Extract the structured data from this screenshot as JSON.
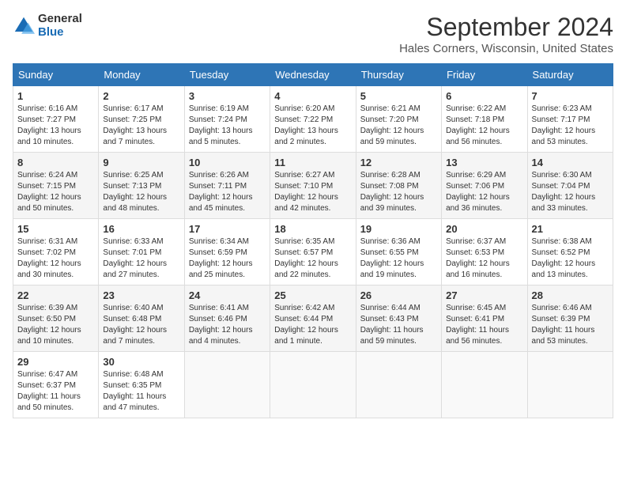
{
  "logo": {
    "general": "General",
    "blue": "Blue"
  },
  "title": "September 2024",
  "location": "Hales Corners, Wisconsin, United States",
  "weekdays": [
    "Sunday",
    "Monday",
    "Tuesday",
    "Wednesday",
    "Thursday",
    "Friday",
    "Saturday"
  ],
  "weeks": [
    [
      {
        "day": "1",
        "info": "Sunrise: 6:16 AM\nSunset: 7:27 PM\nDaylight: 13 hours and 10 minutes."
      },
      {
        "day": "2",
        "info": "Sunrise: 6:17 AM\nSunset: 7:25 PM\nDaylight: 13 hours and 7 minutes."
      },
      {
        "day": "3",
        "info": "Sunrise: 6:19 AM\nSunset: 7:24 PM\nDaylight: 13 hours and 5 minutes."
      },
      {
        "day": "4",
        "info": "Sunrise: 6:20 AM\nSunset: 7:22 PM\nDaylight: 13 hours and 2 minutes."
      },
      {
        "day": "5",
        "info": "Sunrise: 6:21 AM\nSunset: 7:20 PM\nDaylight: 12 hours and 59 minutes."
      },
      {
        "day": "6",
        "info": "Sunrise: 6:22 AM\nSunset: 7:18 PM\nDaylight: 12 hours and 56 minutes."
      },
      {
        "day": "7",
        "info": "Sunrise: 6:23 AM\nSunset: 7:17 PM\nDaylight: 12 hours and 53 minutes."
      }
    ],
    [
      {
        "day": "8",
        "info": "Sunrise: 6:24 AM\nSunset: 7:15 PM\nDaylight: 12 hours and 50 minutes."
      },
      {
        "day": "9",
        "info": "Sunrise: 6:25 AM\nSunset: 7:13 PM\nDaylight: 12 hours and 48 minutes."
      },
      {
        "day": "10",
        "info": "Sunrise: 6:26 AM\nSunset: 7:11 PM\nDaylight: 12 hours and 45 minutes."
      },
      {
        "day": "11",
        "info": "Sunrise: 6:27 AM\nSunset: 7:10 PM\nDaylight: 12 hours and 42 minutes."
      },
      {
        "day": "12",
        "info": "Sunrise: 6:28 AM\nSunset: 7:08 PM\nDaylight: 12 hours and 39 minutes."
      },
      {
        "day": "13",
        "info": "Sunrise: 6:29 AM\nSunset: 7:06 PM\nDaylight: 12 hours and 36 minutes."
      },
      {
        "day": "14",
        "info": "Sunrise: 6:30 AM\nSunset: 7:04 PM\nDaylight: 12 hours and 33 minutes."
      }
    ],
    [
      {
        "day": "15",
        "info": "Sunrise: 6:31 AM\nSunset: 7:02 PM\nDaylight: 12 hours and 30 minutes."
      },
      {
        "day": "16",
        "info": "Sunrise: 6:33 AM\nSunset: 7:01 PM\nDaylight: 12 hours and 27 minutes."
      },
      {
        "day": "17",
        "info": "Sunrise: 6:34 AM\nSunset: 6:59 PM\nDaylight: 12 hours and 25 minutes."
      },
      {
        "day": "18",
        "info": "Sunrise: 6:35 AM\nSunset: 6:57 PM\nDaylight: 12 hours and 22 minutes."
      },
      {
        "day": "19",
        "info": "Sunrise: 6:36 AM\nSunset: 6:55 PM\nDaylight: 12 hours and 19 minutes."
      },
      {
        "day": "20",
        "info": "Sunrise: 6:37 AM\nSunset: 6:53 PM\nDaylight: 12 hours and 16 minutes."
      },
      {
        "day": "21",
        "info": "Sunrise: 6:38 AM\nSunset: 6:52 PM\nDaylight: 12 hours and 13 minutes."
      }
    ],
    [
      {
        "day": "22",
        "info": "Sunrise: 6:39 AM\nSunset: 6:50 PM\nDaylight: 12 hours and 10 minutes."
      },
      {
        "day": "23",
        "info": "Sunrise: 6:40 AM\nSunset: 6:48 PM\nDaylight: 12 hours and 7 minutes."
      },
      {
        "day": "24",
        "info": "Sunrise: 6:41 AM\nSunset: 6:46 PM\nDaylight: 12 hours and 4 minutes."
      },
      {
        "day": "25",
        "info": "Sunrise: 6:42 AM\nSunset: 6:44 PM\nDaylight: 12 hours and 1 minute."
      },
      {
        "day": "26",
        "info": "Sunrise: 6:44 AM\nSunset: 6:43 PM\nDaylight: 11 hours and 59 minutes."
      },
      {
        "day": "27",
        "info": "Sunrise: 6:45 AM\nSunset: 6:41 PM\nDaylight: 11 hours and 56 minutes."
      },
      {
        "day": "28",
        "info": "Sunrise: 6:46 AM\nSunset: 6:39 PM\nDaylight: 11 hours and 53 minutes."
      }
    ],
    [
      {
        "day": "29",
        "info": "Sunrise: 6:47 AM\nSunset: 6:37 PM\nDaylight: 11 hours and 50 minutes."
      },
      {
        "day": "30",
        "info": "Sunrise: 6:48 AM\nSunset: 6:35 PM\nDaylight: 11 hours and 47 minutes."
      },
      {
        "day": "",
        "info": ""
      },
      {
        "day": "",
        "info": ""
      },
      {
        "day": "",
        "info": ""
      },
      {
        "day": "",
        "info": ""
      },
      {
        "day": "",
        "info": ""
      }
    ]
  ]
}
